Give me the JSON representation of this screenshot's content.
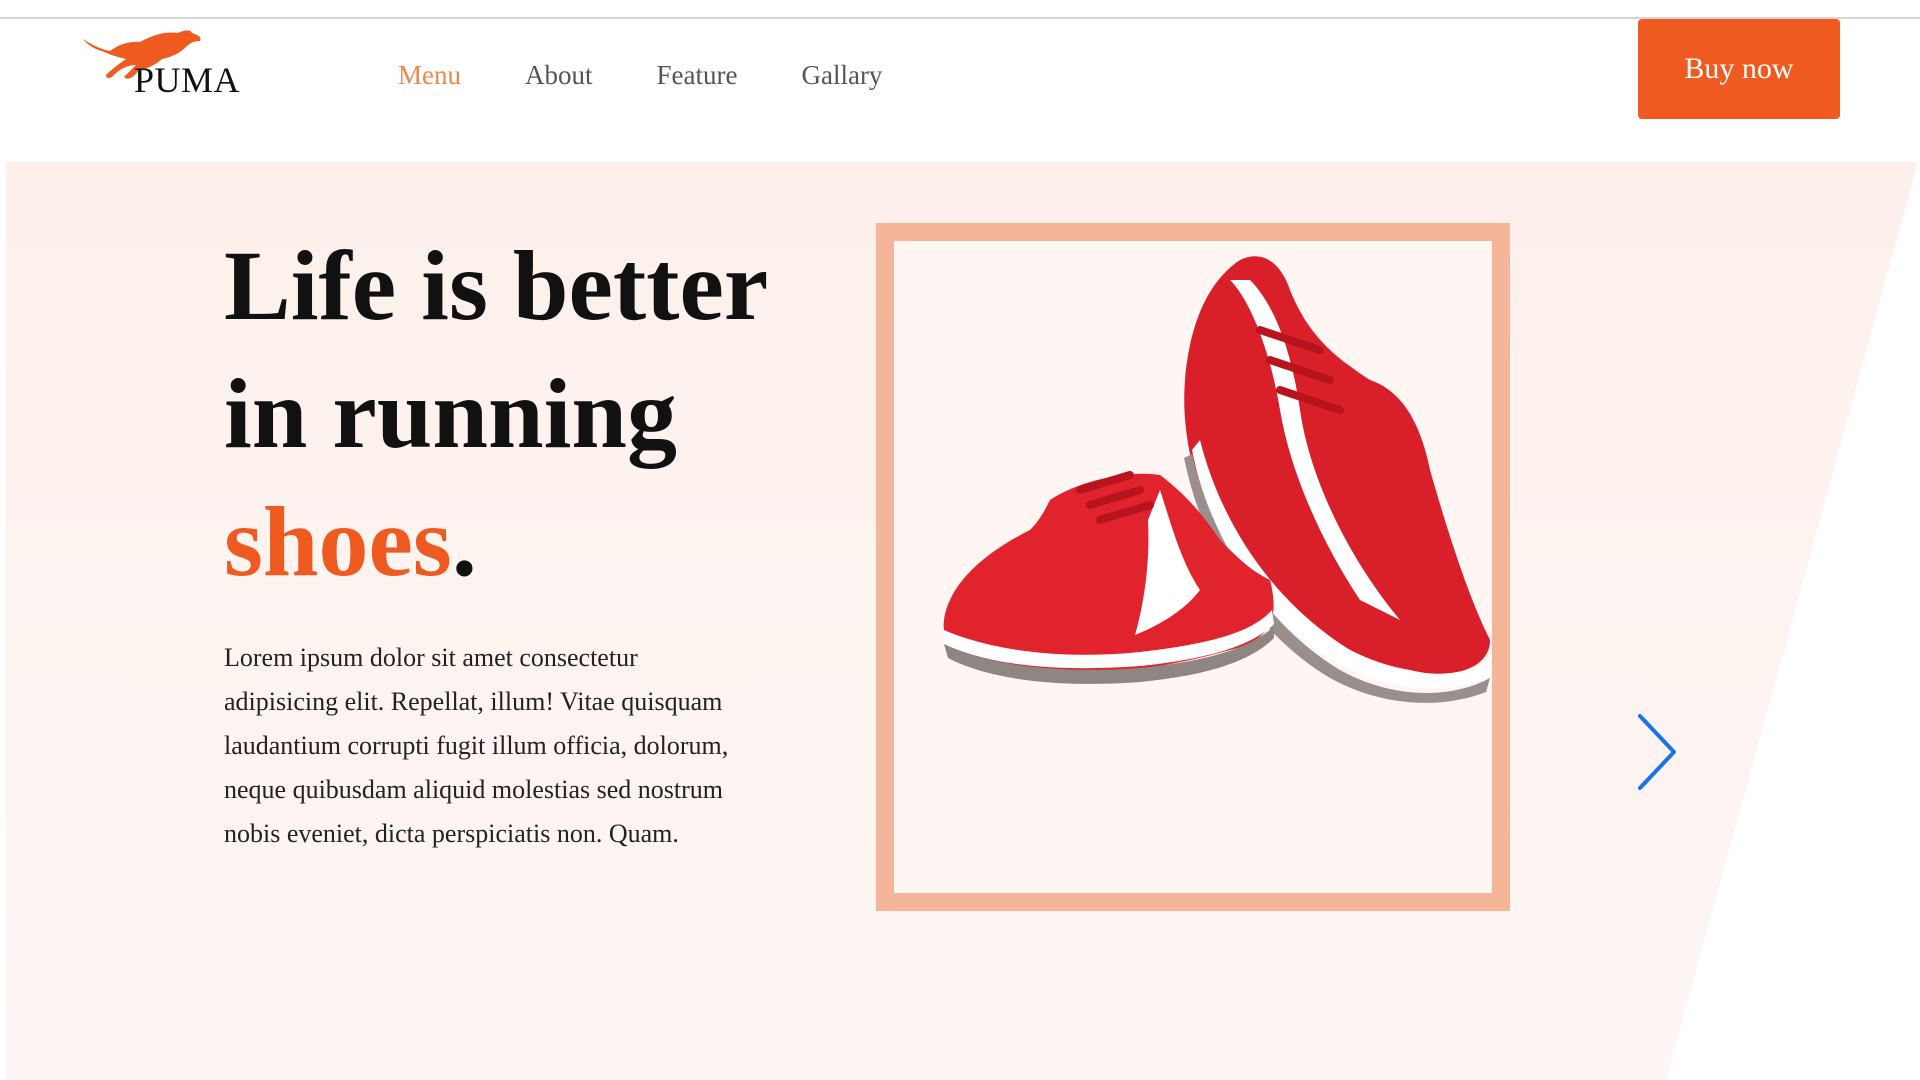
{
  "brand": {
    "name": "PUMA",
    "logo_icon": "puma-leaping-cat-icon"
  },
  "nav": {
    "items": [
      {
        "label": "Menu",
        "active": true
      },
      {
        "label": "About",
        "active": false
      },
      {
        "label": "Feature",
        "active": false
      },
      {
        "label": "Gallary",
        "active": false
      }
    ]
  },
  "header": {
    "cta_label": "Buy now"
  },
  "hero": {
    "headline_line1": "Life is better",
    "headline_line2": "in running",
    "headline_accent": "shoes",
    "headline_end": ".",
    "description": "Lorem ipsum dolor sit amet consectetur adipisicing elit. Repellat, illum! Vitae quisquam laudantium corrupti fugit illum officia, dolorum, neque quibusdam aliquid molestias sed nostrum nobis eveniet, dicta perspiciatis non. Quam.",
    "image_icon": "red-sneakers-image",
    "next_icon": "chevron-right-icon"
  },
  "colors": {
    "accent": "#ee5a1f",
    "nav_active": "#f0874a",
    "frame": "#f5b599",
    "hero_bg": "#fdf0eb",
    "arrow": "#1a73e8"
  }
}
